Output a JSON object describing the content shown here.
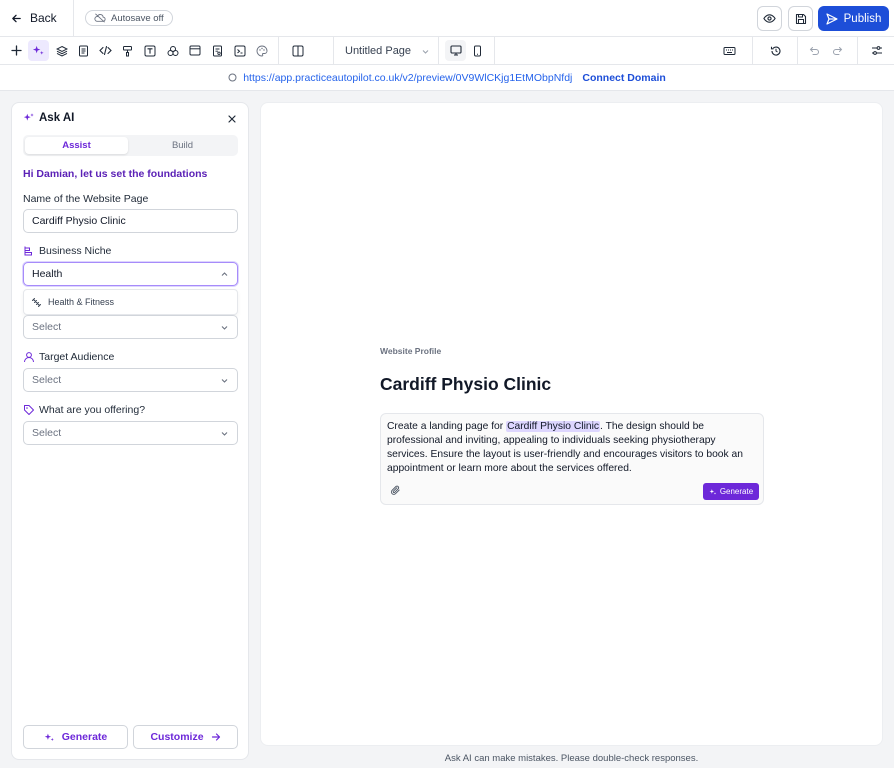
{
  "header": {
    "back_label": "Back",
    "autosave_label": "Autosave off",
    "publish_label": "Publish"
  },
  "toolbar": {
    "page_name": "Untitled Page"
  },
  "urlbar": {
    "url": "https://app.practiceautopilot.co.uk/v2/preview/0V9WlCKjg1EtMObpNfdj",
    "connect_label": "Connect Domain"
  },
  "panel": {
    "title": "Ask AI",
    "tabs": [
      {
        "label": "Assist",
        "active": true
      },
      {
        "label": "Build",
        "active": false
      }
    ],
    "greeting": "Hi Damian, let us set the foundations",
    "page_name_label": "Name of the Website Page",
    "page_name_value": "Cardiff Physio Clinic",
    "niche_label": "Business Niche",
    "niche_value": "Health",
    "niche_option": "Health & Fitness",
    "hidden_select_placeholder": "Select",
    "audience_label": "Target Audience",
    "audience_placeholder": "Select",
    "offering_label": "What are you offering?",
    "offering_placeholder": "Select",
    "generate_label": "Generate",
    "customize_label": "Customize"
  },
  "canvas": {
    "profile_label": "Website Profile",
    "title": "Cardiff Physio Clinic",
    "prompt_prefix": "Create a landing page for ",
    "prompt_highlight": "Cardiff Physio Clinic",
    "prompt_suffix": ". The design should be professional and inviting, appealing to individuals seeking physiotherapy services. Ensure the layout is user-friendly and encourages visitors to book an appointment or learn more about the services offered.",
    "generate_label": "Generate"
  },
  "footer": {
    "disclaimer": "Ask AI can make mistakes. Please double-check responses."
  },
  "colors": {
    "accent_purple": "#6d28d9",
    "publish_blue": "#1d4ed8",
    "link_blue": "#2563eb"
  }
}
